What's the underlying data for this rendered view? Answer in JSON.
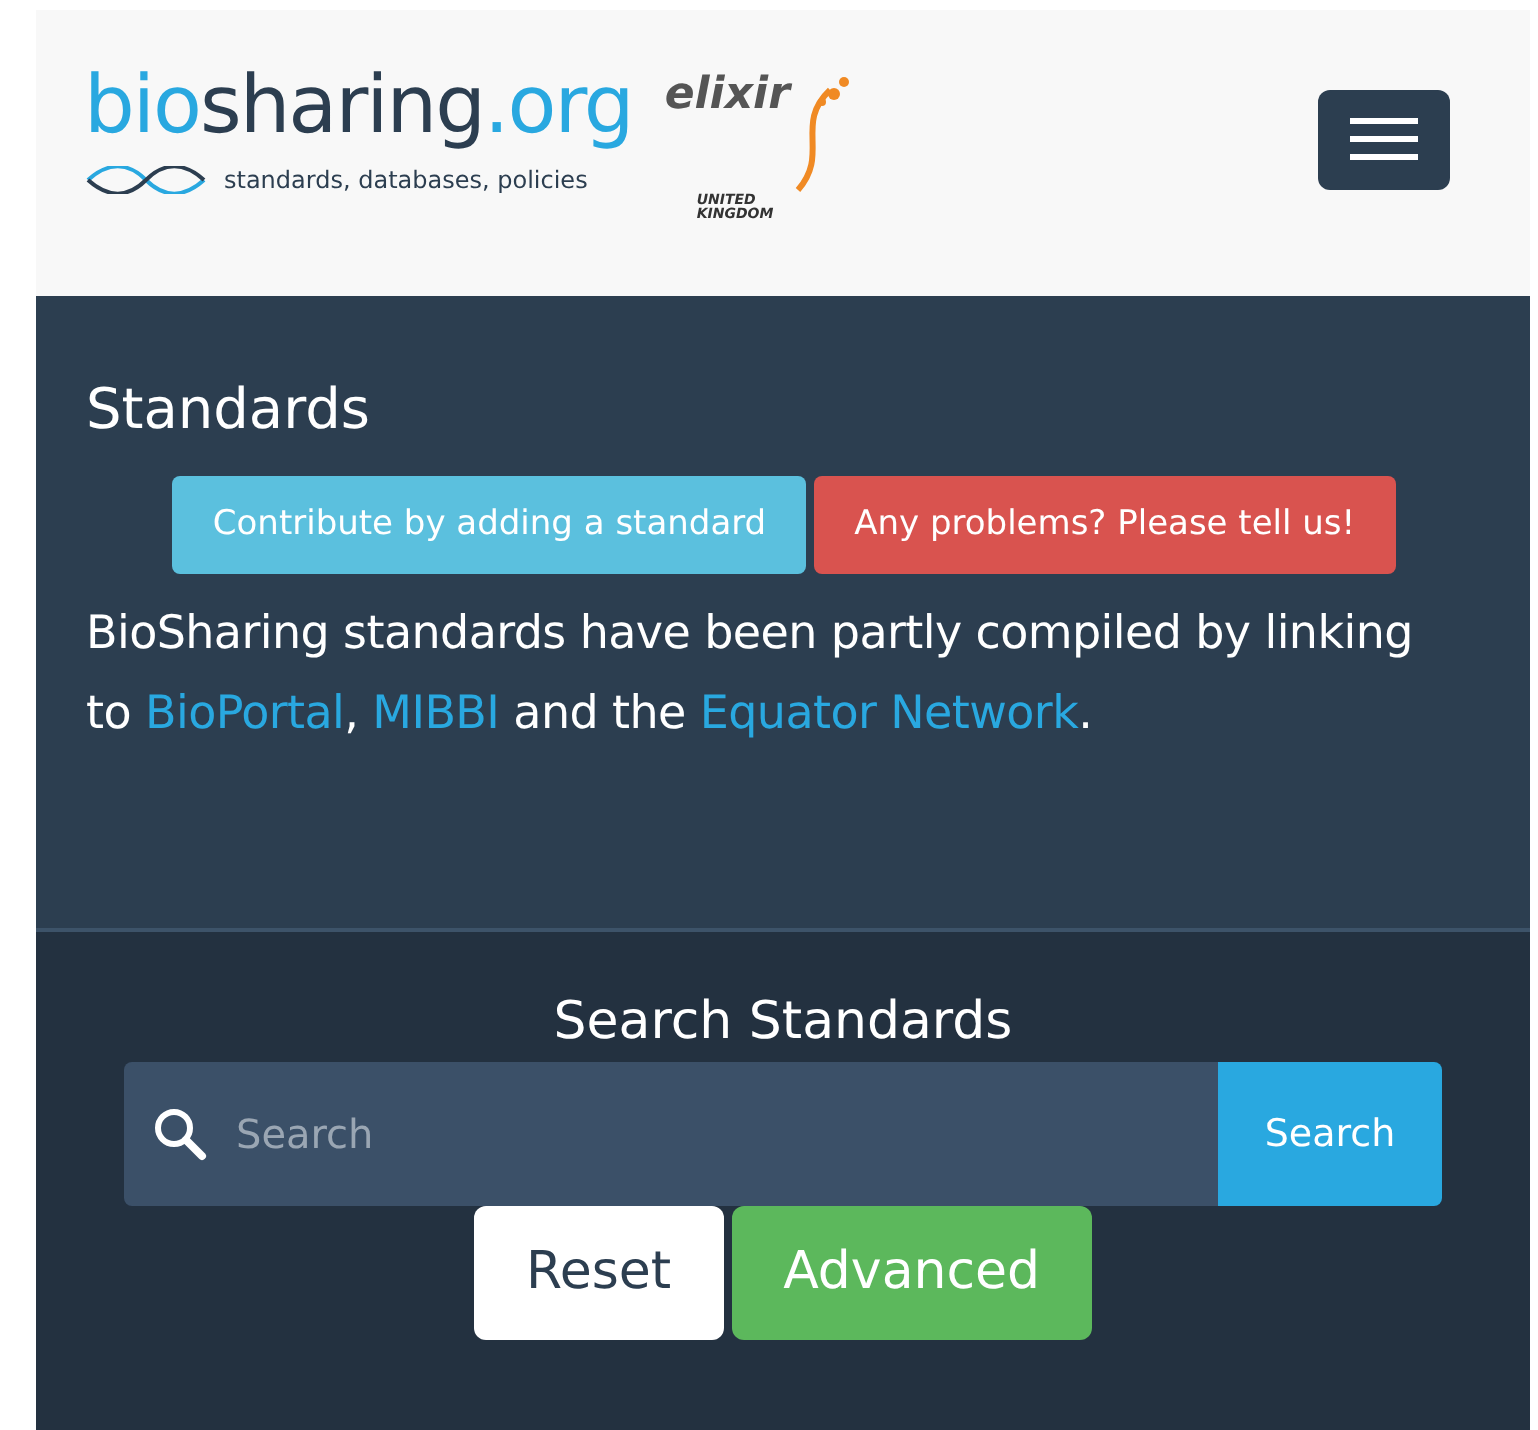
{
  "logo": {
    "parts": [
      {
        "text": "bio",
        "kind": "accent"
      },
      {
        "text": "sharing",
        "kind": "plain"
      },
      {
        "text": ".org",
        "kind": "accent"
      }
    ],
    "tagline": "standards, databases, policies"
  },
  "partner_logo": {
    "name": "elixir",
    "subtitle": [
      "UNITED",
      "KINGDOM"
    ]
  },
  "section": {
    "title": "Standards",
    "buttons": [
      {
        "label": "Contribute by adding a standard",
        "kind": "info"
      },
      {
        "label": "Any problems? Please tell us!",
        "kind": "danger"
      }
    ],
    "intro": [
      {
        "kind": "text",
        "text": "BioSharing standards have been partly compiled by linking to "
      },
      {
        "kind": "link",
        "text": "BioPortal"
      },
      {
        "kind": "text",
        "text": ", "
      },
      {
        "kind": "link",
        "text": "MIBBI"
      },
      {
        "kind": "text",
        "text": " and the "
      },
      {
        "kind": "link",
        "text": "Equator Network"
      },
      {
        "kind": "text",
        "text": "."
      }
    ]
  },
  "search": {
    "title": "Search Standards",
    "placeholder": "Search",
    "button": "Search",
    "actions": [
      {
        "label": "Reset",
        "kind": "light"
      },
      {
        "label": "Advanced",
        "kind": "success"
      }
    ]
  }
}
